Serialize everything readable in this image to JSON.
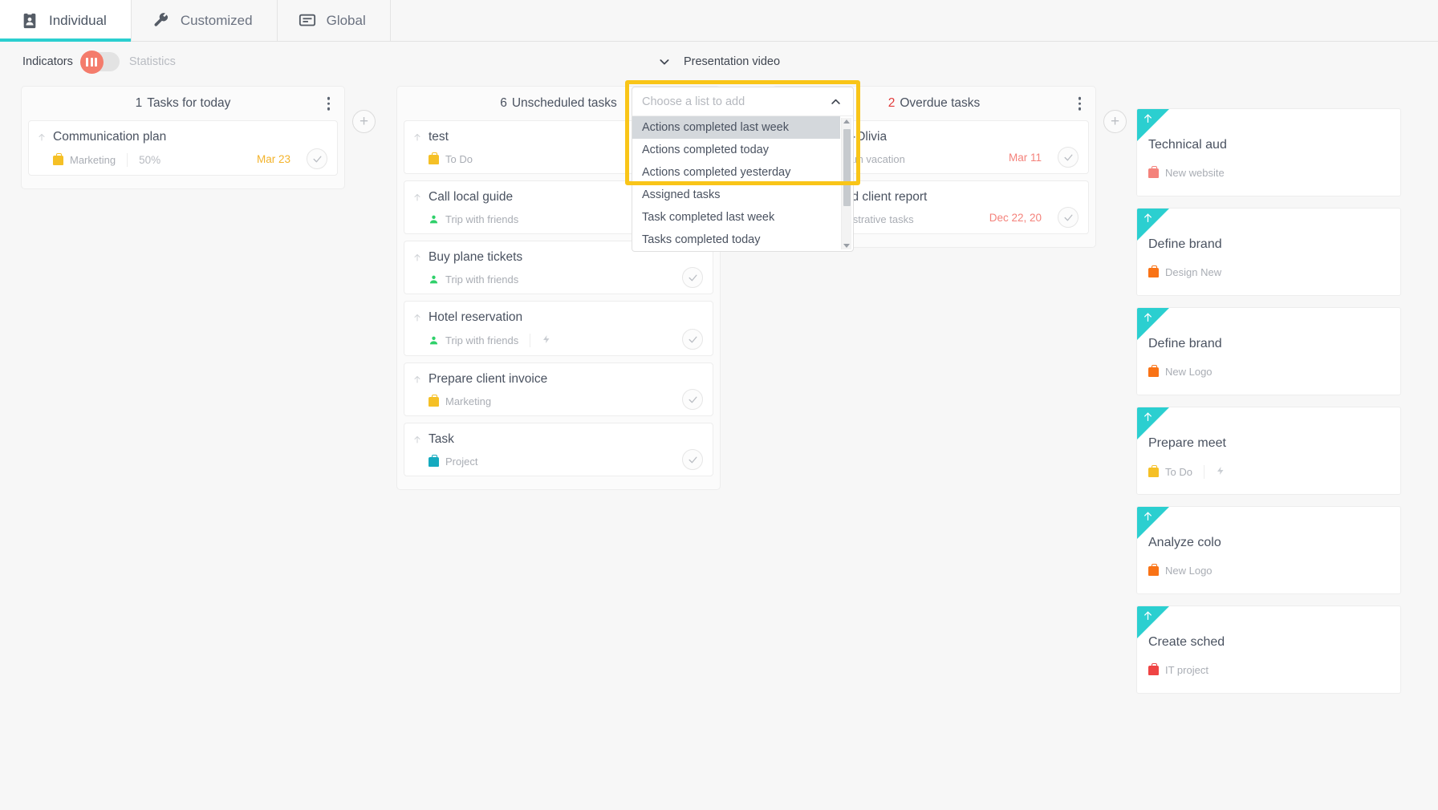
{
  "tabs": [
    {
      "label": "Individual",
      "icon": "contact-card-icon",
      "active": true
    },
    {
      "label": "Customized",
      "icon": "wrench-icon",
      "active": false
    },
    {
      "label": "Global",
      "icon": "monitor-icon",
      "active": false
    }
  ],
  "subheader": {
    "indicators_label": "Indicators",
    "statistics_label": "Statistics",
    "toggle_state": "indicators",
    "presentation_label": "Presentation video"
  },
  "columns": [
    {
      "count": "1",
      "title": "Tasks for today",
      "count_color": "#4a5260",
      "cards": [
        {
          "title": "Communication plan",
          "tag": "Marketing",
          "tag_color": "#f5c026",
          "tag_icon": "briefcase-icon",
          "percent": "50%",
          "due": "Mar 23",
          "due_color": "#f3b32b",
          "has_bolt": false,
          "has_share": false
        }
      ]
    },
    {
      "count": "6",
      "title": "Unscheduled tasks",
      "count_color": "#4a5260",
      "cards": [
        {
          "title": "test",
          "tag": "To Do",
          "tag_color": "#f5c026",
          "tag_icon": "briefcase-icon",
          "percent": "",
          "due": "",
          "due_color": "",
          "has_bolt": false,
          "has_share": false
        },
        {
          "title": "Call local guide",
          "tag": "Trip with friends",
          "tag_color": "#2fd06a",
          "tag_icon": "person-icon",
          "percent": "",
          "due": "",
          "due_color": "",
          "has_bolt": false,
          "has_share": false
        },
        {
          "title": "Buy plane tickets",
          "tag": "Trip with friends",
          "tag_color": "#2fd06a",
          "tag_icon": "person-icon",
          "percent": "",
          "due": "",
          "due_color": "",
          "has_bolt": false,
          "has_share": false
        },
        {
          "title": "Hotel reservation",
          "tag": "Trip with friends",
          "tag_color": "#2fd06a",
          "tag_icon": "person-icon",
          "percent": "",
          "due": "",
          "due_color": "",
          "has_bolt": true,
          "has_share": false
        },
        {
          "title": "Prepare client invoice",
          "tag": "Marketing",
          "tag_color": "#f5c026",
          "tag_icon": "briefcase-icon",
          "percent": "",
          "due": "",
          "due_color": "",
          "has_bolt": false,
          "has_share": false
        },
        {
          "title": "Task",
          "tag": "Project",
          "tag_color": "#15aabf",
          "tag_icon": "briefcase-icon",
          "percent": "",
          "due": "",
          "due_color": "",
          "has_bolt": false,
          "has_share": false
        }
      ]
    },
    {
      "count": "2",
      "title": "Overdue tasks",
      "count_color": "#e23b3b",
      "cards": [
        {
          "title": "Vacation-Olivia",
          "tag": "Team vacation",
          "tag_color": "#ef4444",
          "tag_icon": "briefcase-icon",
          "percent": "",
          "due": "Mar 11",
          "due_color": "#f4827b",
          "has_bolt": false,
          "has_share": true
        },
        {
          "title": "Proofread client report",
          "tag": "Administrative tasks",
          "tag_color": "#7ec8e3",
          "tag_icon": "briefcase-icon",
          "percent": "",
          "due": "Dec 22, 20",
          "due_color": "#f4827b",
          "has_bolt": false,
          "has_share": false
        }
      ]
    }
  ],
  "right_cards": [
    {
      "title": "Technical aud",
      "tag": "New website",
      "tag_color": "#f4827b"
    },
    {
      "title": "Define brand",
      "tag": "Design New",
      "tag_color": "#f97316"
    },
    {
      "title": "Define brand",
      "tag": "New Logo",
      "tag_color": "#f97316"
    },
    {
      "title": "Prepare meet",
      "tag": "To Do",
      "tag_color": "#f5c026"
    },
    {
      "title": "Analyze colo",
      "tag": "New Logo",
      "tag_color": "#f97316"
    },
    {
      "title": "Create sched",
      "tag": "IT project",
      "tag_color": "#ef4444"
    }
  ],
  "dropdown": {
    "placeholder": "Choose a list to add",
    "value": "",
    "expanded": true,
    "options": [
      "Actions completed last week",
      "Actions completed today",
      "Actions completed yesterday",
      "Assigned tasks",
      "Task completed last week",
      "Tasks completed today"
    ],
    "selected_index": 0
  },
  "highlight_color": "#f9c518",
  "accent_color": "#2bcfd0"
}
